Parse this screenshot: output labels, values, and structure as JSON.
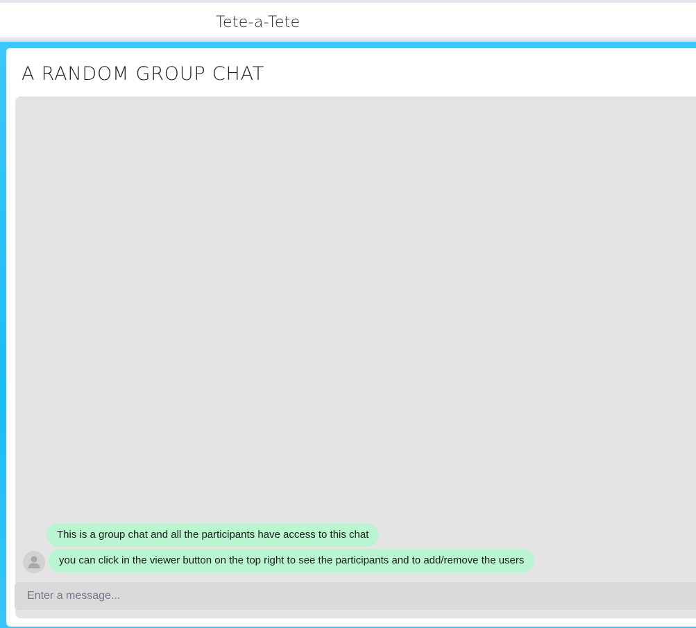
{
  "app": {
    "title": "Tete-a-Tete"
  },
  "chat": {
    "title": "A RANDOM GROUP CHAT",
    "messages": [
      {
        "text": "This is a group chat and all the participants have access to this chat"
      },
      {
        "text": "you can click in the viewer button on the top right to see the participants and to add/remove the users"
      }
    ],
    "avatar_icon": "user-silhouette-icon",
    "input": {
      "value": "",
      "placeholder": "Enter a message..."
    }
  },
  "colors": {
    "frame_accent": "#18bdf7",
    "message_bubble": "#b9f5d0",
    "panel_background": "#e4e4e4",
    "input_background": "#dadada"
  }
}
